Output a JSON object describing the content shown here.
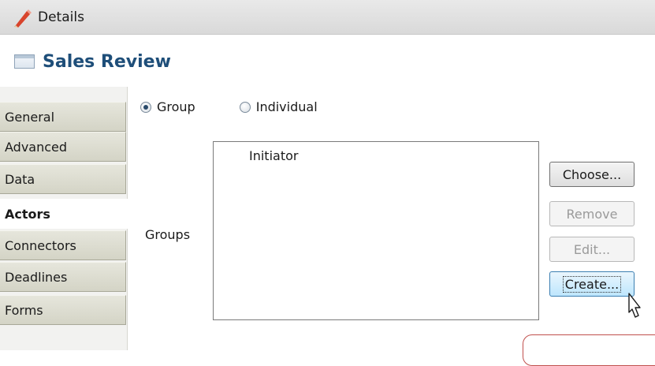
{
  "window": {
    "title": "Details"
  },
  "header": {
    "title": "Sales Review"
  },
  "nav": {
    "items": [
      {
        "label": "General",
        "active": false
      },
      {
        "label": "Advanced",
        "active": false
      },
      {
        "label": "Data",
        "active": false
      },
      {
        "label": "Actors",
        "active": true
      },
      {
        "label": "Connectors",
        "active": false
      },
      {
        "label": "Deadlines",
        "active": false
      },
      {
        "label": "Forms",
        "active": false
      }
    ]
  },
  "actors": {
    "radio_group_label": "Group",
    "radio_individual_label": "Individual",
    "selected": "Group",
    "groups_label": "Groups",
    "groups_list": [
      "Initiator"
    ]
  },
  "buttons": {
    "choose": "Choose...",
    "remove": "Remove",
    "edit": "Edit...",
    "create": "Create..."
  },
  "colors": {
    "header_title": "#1e4e79",
    "callout_border": "#c0504d",
    "hover_border": "#3c7fb1"
  },
  "icons": {
    "title": "pencil-icon",
    "header": "window-icon",
    "cursor": "mouse-pointer-icon"
  }
}
